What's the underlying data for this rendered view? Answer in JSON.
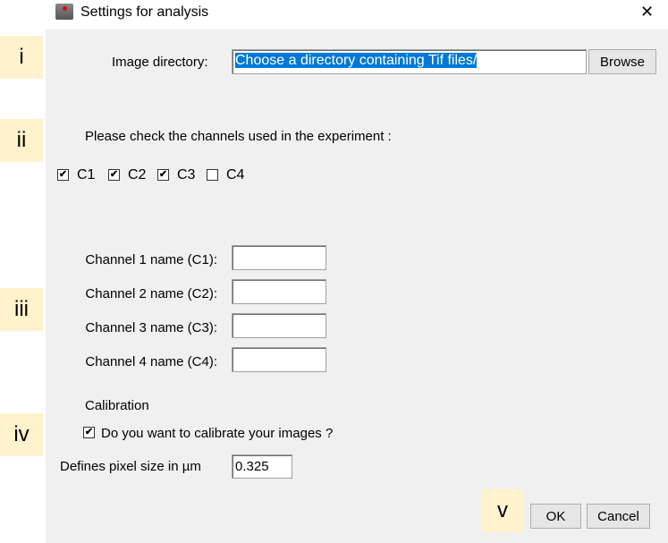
{
  "window": {
    "title": "Settings for analysis",
    "close": "✕"
  },
  "tags": [
    "i",
    "ii",
    "iii",
    "iv",
    "v"
  ],
  "directory": {
    "label": "Image directory:",
    "value": "Choose a directory containing Tif files/",
    "browse": "Browse"
  },
  "channels": {
    "prompt": "Please check the channels used in the experiment :",
    "items": [
      {
        "label": "C1",
        "checked": true
      },
      {
        "label": "C2",
        "checked": true
      },
      {
        "label": "C3",
        "checked": true
      },
      {
        "label": "C4",
        "checked": false
      }
    ]
  },
  "names": [
    {
      "label": "Channel 1 name (C1):",
      "value": ""
    },
    {
      "label": "Channel 2 name (C2):",
      "value": ""
    },
    {
      "label": "Channel 3 name (C3):",
      "value": ""
    },
    {
      "label": "Channel 4 name (C4):",
      "value": ""
    }
  ],
  "calibration": {
    "heading": "Calibration",
    "checkbox_label": "Do you want to calibrate your images ?",
    "checked": true,
    "pixel_label": "Defines pixel size in µm",
    "pixel_value": "0.325"
  },
  "buttons": {
    "ok": "OK",
    "cancel": "Cancel"
  }
}
